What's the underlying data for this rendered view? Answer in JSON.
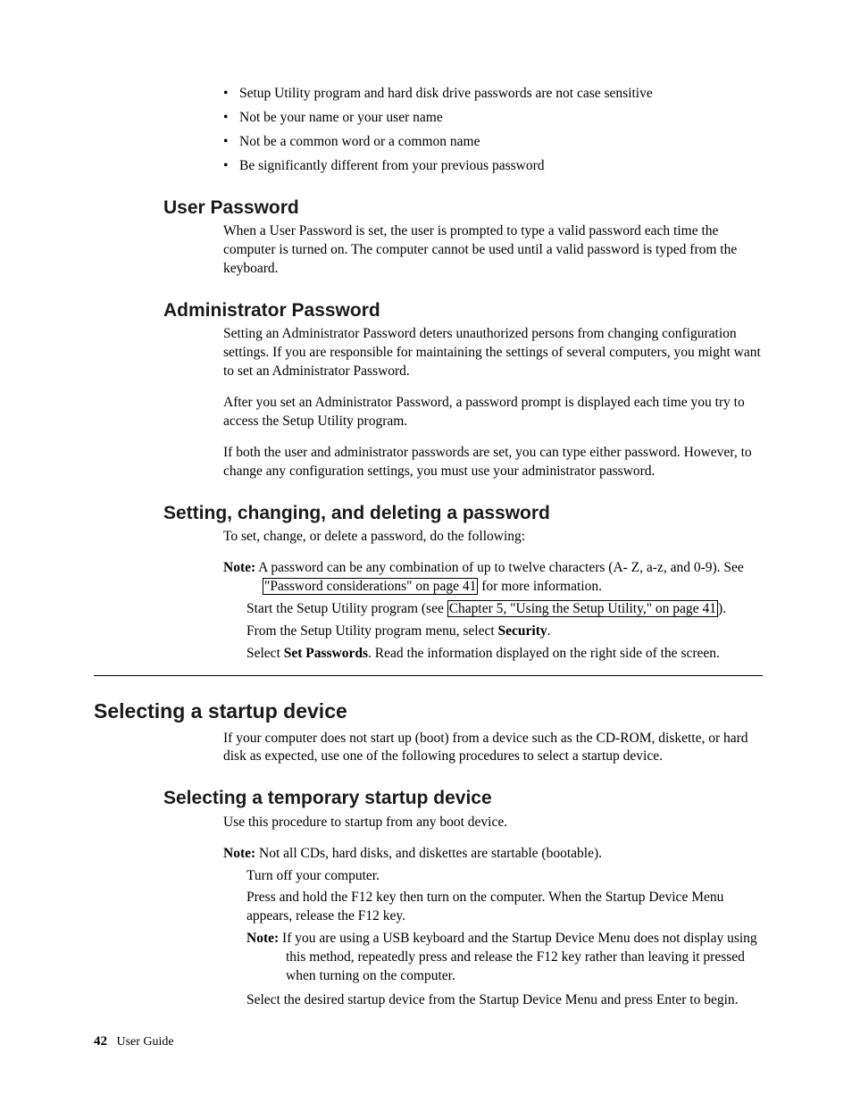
{
  "bullets": [
    "Setup Utility program and hard disk drive passwords are not case sensitive",
    "Not be your name or your user name",
    "Not be a common word or a common name",
    "Be significantly different from your previous password"
  ],
  "userPassword": {
    "heading": "User Password",
    "p1": "When a User Password is set, the user is prompted to type a valid password each time the computer is turned on. The computer cannot be used until a valid password is typed from the keyboard."
  },
  "adminPassword": {
    "heading": "Administrator Password",
    "p1": "Setting an Administrator Password deters unauthorized persons from changing configuration settings. If you are responsible for maintaining the settings of several computers, you might want to set an Administrator Password.",
    "p2": "After you set an Administrator Password, a password prompt is displayed each time you try to access the Setup Utility program.",
    "p3": "If both the user and administrator passwords are set, you can type either password. However, to change any configuration settings, you must use your administrator password."
  },
  "setChange": {
    "heading": "Setting, changing, and deleting a password",
    "intro": "To set, change, or delete a password, do the following:",
    "noteLabel": "Note:",
    "noteBody1": " A password can be any combination of up to twelve characters (A- Z, a-z, and 0-9). See ",
    "noteLink": "\"Password considerations\" on page 41",
    "noteBody2": " for more information.",
    "step1a": "Start the Setup Utility program (see ",
    "step1link": "Chapter 5, \"Using the Setup Utility,\" on page 41",
    "step1b": ").",
    "step2a": "From the Setup Utility program menu, select ",
    "step2bold": "Security",
    "step2b": ".",
    "step3a": "Select ",
    "step3bold": "Set Passwords",
    "step3b": ". Read the information displayed on the right side of the screen."
  },
  "selStartup": {
    "heading": "Selecting a startup device",
    "p1": "If your computer does not start up (boot) from a device such as the CD-ROM, diskette, or hard disk as expected, use one of the following procedures to select a startup device."
  },
  "tempStartup": {
    "heading": "Selecting a temporary startup device",
    "intro": "Use this procedure to startup from any boot device.",
    "noteLabel": "Note:",
    "noteBody": " Not all CDs, hard disks, and diskettes are startable (bootable).",
    "step1": "Turn off your computer.",
    "step2": "Press and hold the F12 key then turn on the computer. When the Startup Device Menu appears, release the F12 key.",
    "innerNoteLabel": "Note:",
    "innerNoteBody": " If you are using a USB keyboard and the Startup Device Menu does not display using this method, repeatedly press and release the F12 key rather than leaving it pressed when turning on the computer.",
    "step3": "Select the desired startup device from the Startup Device Menu and press Enter to begin."
  },
  "footer": {
    "pageNum": "42",
    "book": "User Guide"
  }
}
